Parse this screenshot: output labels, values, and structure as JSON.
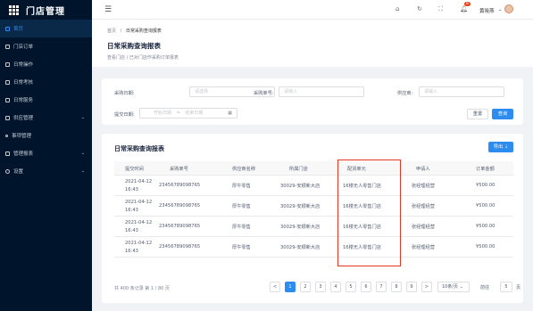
{
  "app": {
    "name": "门店管理"
  },
  "sidebar": {
    "items": [
      {
        "label": "首页"
      },
      {
        "label": "门店订单"
      },
      {
        "label": "日常操作"
      },
      {
        "label": "日常考核"
      },
      {
        "label": "日常服务"
      },
      {
        "label": "供应管理"
      },
      {
        "label": "事项管理"
      },
      {
        "label": "管理报表"
      },
      {
        "label": "设置"
      }
    ]
  },
  "topbar": {
    "notification_count": "8",
    "user_name": "黄晓燕"
  },
  "breadcrumb": {
    "root": "首页",
    "sep": "/",
    "current": "日常采购查询报表"
  },
  "page": {
    "title": "日常采购查询报表",
    "description": "查看门店 / 已对门店作采购订单报表"
  },
  "filters": {
    "date_label": "采购日期:",
    "date_placeholder": "请选择",
    "order_label": "采购单号:",
    "order_placeholder": "请输入",
    "supplier_label": "供应商:",
    "supplier_placeholder": "请输入",
    "submit_label": "提交日期:",
    "start_placeholder": "开始日期",
    "range_sep": "~",
    "end_placeholder": "结束日期",
    "reset_button": "重置",
    "query_button": "查询"
  },
  "table": {
    "title": "日常采购查询报表",
    "export_button": "导出",
    "columns": [
      "提交时间",
      "采购单号",
      "供应商名称",
      "所属门店",
      "配货单元",
      "申请人",
      "订单金额"
    ],
    "rows": [
      {
        "date": "2021-04-12",
        "time": "16:43",
        "order": "23456789098765",
        "supplier": "厚牛零售",
        "store": "30029-安顺新大店",
        "unit": "16楼无人零售门店",
        "applicant": "张经理经营",
        "amount": "¥500.00"
      },
      {
        "date": "2021-04-12",
        "time": "16:43",
        "order": "23456789098765",
        "supplier": "厚牛零售",
        "store": "30029-安顺新大店",
        "unit": "16楼无人零售门店",
        "applicant": "张经理经营",
        "amount": "¥500.00"
      },
      {
        "date": "2021-04-12",
        "time": "16:43",
        "order": "23456789098765",
        "supplier": "厚牛零售",
        "store": "30029-安顺新大店",
        "unit": "16楼无人零售门店",
        "applicant": "张经理经营",
        "amount": "¥500.00"
      },
      {
        "date": "2021-04-12",
        "time": "16:43",
        "order": "23456789098765",
        "supplier": "厚牛零售",
        "store": "30029-安顺新大店",
        "unit": "16楼无人零售门店",
        "applicant": "张经理经营",
        "amount": "¥500.00"
      }
    ]
  },
  "pagination": {
    "total_text": "共 400 条记录 第 1 / 80 页",
    "prev": "<",
    "pages": [
      "1",
      "2",
      "3",
      "4",
      "5",
      "6",
      "7",
      "8",
      "9"
    ],
    "next": ">",
    "page_size": "10条/页",
    "goto_label": "前往",
    "goto_value": "5",
    "goto_suffix": "页"
  }
}
